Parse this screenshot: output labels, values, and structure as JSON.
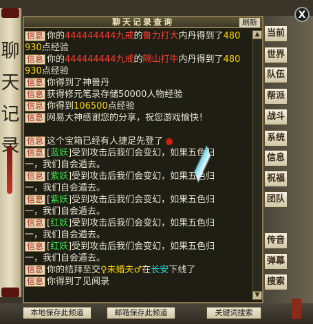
{
  "window": {
    "title": "聊天记录查询",
    "refresh_label": "刷新",
    "close_label": "X"
  },
  "scroll_title": "聊天记录",
  "tag_label": "信息",
  "log": [
    {
      "segments": [
        {
          "t": "你的"
        },
        {
          "t": "444444444九戒",
          "c": "red"
        },
        {
          "t": "的"
        },
        {
          "t": "鲁力打大",
          "c": "red"
        },
        {
          "t": "内丹得到了"
        },
        {
          "t": "480",
          "c": "yel"
        }
      ],
      "cont": [
        {
          "t": "930",
          "c": "yel"
        },
        {
          "t": "点经验"
        }
      ]
    },
    {
      "segments": [
        {
          "t": "你的"
        },
        {
          "t": "444444444九戒",
          "c": "red"
        },
        {
          "t": "的"
        },
        {
          "t": "隔山打牛",
          "c": "red"
        },
        {
          "t": "内丹得到了"
        },
        {
          "t": "480",
          "c": "yel"
        }
      ],
      "cont": [
        {
          "t": "930",
          "c": "yel"
        },
        {
          "t": "点经验"
        }
      ]
    },
    {
      "segments": [
        {
          "t": "你得到了神兽丹"
        }
      ]
    },
    {
      "segments": [
        {
          "t": "获得修元笔录存储50000人物经验"
        }
      ]
    },
    {
      "segments": [
        {
          "t": "你得到"
        },
        {
          "t": "106500",
          "c": "yel"
        },
        {
          "t": "点经验"
        }
      ]
    },
    {
      "segments": [
        {
          "t": "网易大神感谢您的分享，祝您游戏愉快！"
        }
      ]
    },
    {
      "blank": true
    },
    {
      "segments": [
        {
          "t": "这个宝箱已经有人捷足先登了"
        }
      ],
      "flower": true
    },
    {
      "segments": [
        {
          "t": "["
        },
        {
          "t": "蓝妖",
          "c": "grn"
        },
        {
          "t": "]受到攻击后我们会变幻，如果五色归"
        }
      ],
      "cont": [
        {
          "t": "一，我们自会遁去。"
        }
      ]
    },
    {
      "segments": [
        {
          "t": "["
        },
        {
          "t": "紫妖",
          "c": "grn"
        },
        {
          "t": "]受到攻击后我们会变幻，如果五色归"
        }
      ],
      "cont": [
        {
          "t": "一，我们自会遁去。"
        }
      ]
    },
    {
      "segments": [
        {
          "t": "["
        },
        {
          "t": "紫妖",
          "c": "grn"
        },
        {
          "t": "]受到攻击后我们会变幻，如果五色归"
        }
      ],
      "cont": [
        {
          "t": "一，我们自会遁去。"
        }
      ]
    },
    {
      "segments": [
        {
          "t": "["
        },
        {
          "t": "红妖",
          "c": "grn"
        },
        {
          "t": "]受到攻击后我们会变幻，如果五色归"
        }
      ],
      "cont": [
        {
          "t": "一，我们自会遁去。"
        }
      ]
    },
    {
      "segments": [
        {
          "t": "["
        },
        {
          "t": "红妖",
          "c": "grn"
        },
        {
          "t": "]受到攻击后我们会变幻，如果五色归"
        }
      ],
      "cont": [
        {
          "t": "一，我们自会遁去。"
        }
      ]
    },
    {
      "segments": [
        {
          "t": "你的结拜至交"
        },
        {
          "t": "♀未婚夫♂",
          "c": "yel"
        },
        {
          "t": "在"
        },
        {
          "t": "长安",
          "c": "cyan"
        },
        {
          "t": "下线了"
        }
      ]
    },
    {
      "segments": [
        {
          "t": "你得到了见闻录"
        }
      ]
    }
  ],
  "side_buttons": [
    "当前",
    "世界",
    "队伍",
    "帮派",
    "战斗",
    "系统",
    "信息",
    "祝福",
    "团队",
    "传音",
    "弹幕",
    "搜索"
  ],
  "bottom_buttons": [
    "本地保存此频道",
    "邮箱保存此频道",
    "关键词搜索"
  ],
  "colors": {
    "tag_text": "#b02a1e",
    "yellow": "#ffd400",
    "red": "#ff3b2a",
    "green": "#3fe04a",
    "cyan": "#1fe0e0"
  }
}
